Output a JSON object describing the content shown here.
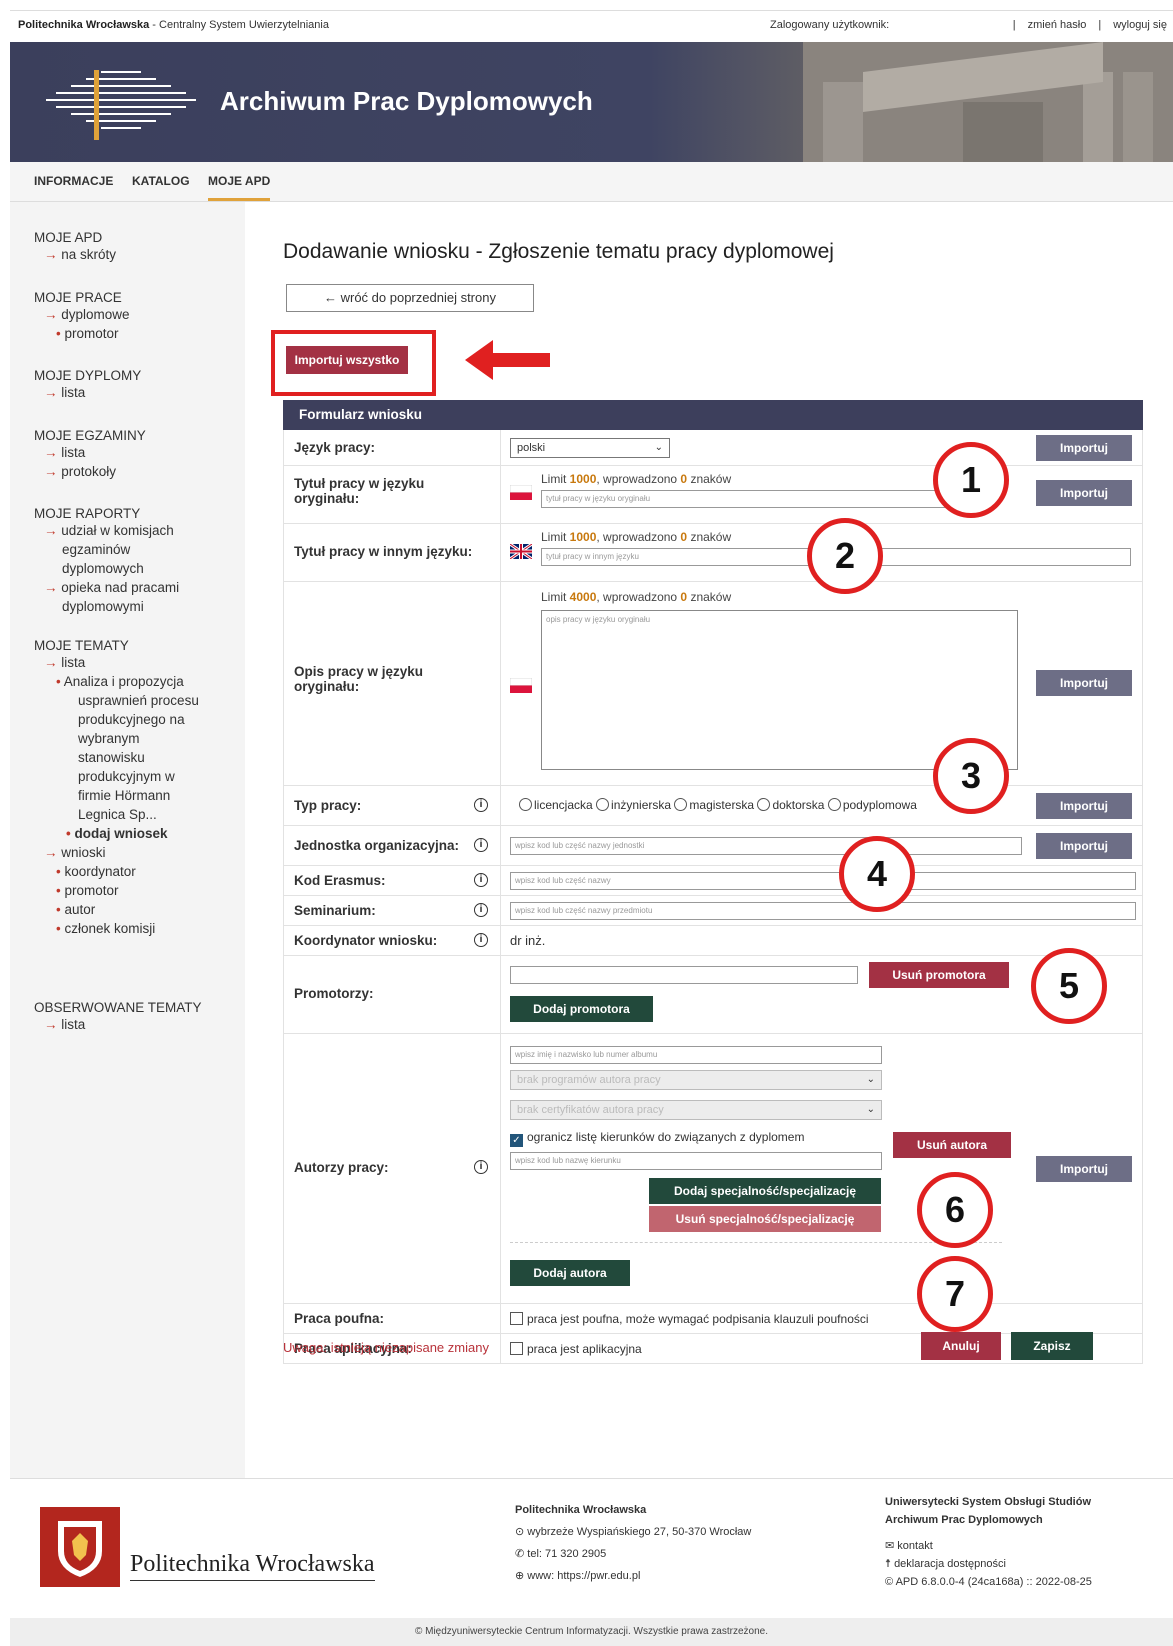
{
  "topbar": {
    "brand_bold": "Politechnika Wrocławska",
    "brand_rest": " - Centralny System Uwierzytelniania",
    "user_label": "Zalogowany użytkownik:",
    "sep": "|",
    "change_password": "zmień hasło",
    "logout": "wyloguj się"
  },
  "banner": {
    "title": "Archiwum Prac Dyplomowych"
  },
  "nav": {
    "info": "INFORMACJE",
    "catalog": "KATALOG",
    "my_apd": "MOJE APD"
  },
  "sidebar": {
    "moje_apd": {
      "head": "MOJE APD",
      "items": [
        "na skróty"
      ]
    },
    "moje_prace": {
      "head": "MOJE PRACE",
      "items": [
        "dyplomowe"
      ],
      "sub": [
        "promotor"
      ]
    },
    "moje_dyplomy": {
      "head": "MOJE DYPLOMY",
      "items": [
        "lista"
      ]
    },
    "moje_egzaminy": {
      "head": "MOJE EGZAMINY",
      "items": [
        "lista",
        "protokoły"
      ]
    },
    "moje_raporty": {
      "head": "MOJE RAPORTY",
      "item1": [
        "udział w komisjach",
        "egzaminów",
        "dyplomowych"
      ],
      "item2": [
        "opieka nad pracami",
        "dyplomowymi"
      ]
    },
    "moje_tematy": {
      "head": "MOJE TEMATY",
      "lista": "lista",
      "topic": [
        "Analiza i propozycja",
        "usprawnień procesu",
        "produkcyjnego na",
        "wybranym",
        "stanowisku",
        "produkcyjnym w",
        "firmie Hörmann",
        "Legnica Sp..."
      ],
      "add": "dodaj wniosek",
      "wnioski": "wnioski",
      "roles": [
        "koordynator",
        "promotor",
        "autor",
        "członek komisji"
      ]
    },
    "obserwowane": {
      "head": "OBSERWOWANE TEMATY",
      "items": [
        "lista"
      ]
    },
    "arrow": "→",
    "bullet": "•"
  },
  "page": {
    "title": "Dodawanie wniosku - Zgłoszenie tematu pracy dyplomowej",
    "back": "← wróć do poprzedniej strony",
    "import_all": "Importuj wszystko"
  },
  "form": {
    "header": "Formularz wniosku",
    "import": "Importuj",
    "info_glyph": "i",
    "language": {
      "label": "Język pracy:",
      "value": "polski"
    },
    "title_orig": {
      "label": "Tytuł pracy w języku oryginału:",
      "limit_pre": "Limit ",
      "limit_num": "1000",
      "limit_mid": ", wprowadzono ",
      "limit_count": "0",
      "limit_post": " znaków",
      "placeholder": "tytuł pracy w języku oryginału"
    },
    "title_other": {
      "label": "Tytuł pracy w innym języku:",
      "limit_pre": "Limit ",
      "limit_num": "1000",
      "limit_mid": ", wprowadzono ",
      "limit_count": "0",
      "limit_post": " znaków",
      "placeholder": "tytuł pracy w innym języku"
    },
    "description": {
      "label": "Opis pracy w języku oryginału:",
      "limit_pre": "Limit ",
      "limit_num": "4000",
      "limit_mid": ", wprowadzono ",
      "limit_count": "0",
      "limit_post": " znaków",
      "placeholder": "opis pracy w języku oryginału"
    },
    "type": {
      "label": "Typ pracy:",
      "options": [
        "licencjacka",
        "inżynierska",
        "magisterska",
        "doktorska",
        "podyplomowa"
      ]
    },
    "unit": {
      "label": "Jednostka organizacyjna:",
      "placeholder": "wpisz kod lub część nazwy jednostki"
    },
    "erasmus": {
      "label": "Kod Erasmus:",
      "placeholder": "wpisz kod lub część nazwy"
    },
    "seminar": {
      "label": "Seminarium:",
      "placeholder": "wpisz kod lub część nazwy przedmiotu"
    },
    "coordinator": {
      "label": "Koordynator wniosku:",
      "value": "dr inż."
    },
    "promoters": {
      "label": "Promotorzy:",
      "remove": "Usuń promotora",
      "add": "Dodaj promotora"
    },
    "authors": {
      "label": "Autorzy pracy:",
      "name_placeholder": "wpisz imię i nazwisko lub numer albumu",
      "programs": "brak programów autora pracy",
      "certs": "brak certyfikatów autora pracy",
      "limit_check": "ogranicz listę kierunków do związanych z dyplomem",
      "field_placeholder": "wpisz kod lub nazwę kierunku",
      "remove_author": "Usuń autora",
      "add_spec": "Dodaj specjalność/specjalizację",
      "remove_spec": "Usuń specjalność/specjalizację",
      "add_author": "Dodaj autora"
    },
    "confidential": {
      "label": "Praca poufna:",
      "text": "praca jest poufna, może wymagać podpisania klauzuli poufności"
    },
    "applied": {
      "label": "Praca aplikacyjna:",
      "text": "praca jest aplikacyjna"
    }
  },
  "markers": [
    "1",
    "2",
    "3",
    "4",
    "5",
    "6",
    "7"
  ],
  "actions": {
    "warning": "Uwaga: istnieją niezapisane zmiany",
    "cancel": "Anuluj",
    "save": "Zapisz"
  },
  "footer": {
    "name": "Politechnika Wrocławska",
    "col1_title": "Politechnika Wrocławska",
    "address": "wybrzeże Wyspiańskiego 27, 50-370 Wrocław",
    "phone": "tel: 71 320 2905",
    "www": "www: https://pwr.edu.pl",
    "col2_title1": "Uniwersytecki System Obsługi Studiów",
    "col2_title2": "Archiwum Prac Dyplomowych",
    "contact": "kontakt",
    "accessibility": "deklaracja dostępności",
    "version": "APD 6.8.0.0-4 (24ca168a) :: 2022-08-25",
    "copyright": "© Międzyuniwersyteckie Centrum Informatyzacji. Wszystkie prawa zastrzeżone."
  },
  "colors": {
    "header_bg": "#3d3f5c",
    "import_btn": "#6d6e86",
    "red_btn": "#a33144",
    "green_btn": "#22493b",
    "marker_red": "#e02020",
    "limit_orange": "#c8790e"
  }
}
